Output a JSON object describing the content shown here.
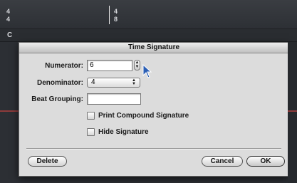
{
  "score": {
    "time_sig_left": [
      "4",
      "4"
    ],
    "time_sig_right": [
      "4",
      "8"
    ],
    "clef_letter": "C"
  },
  "dialog": {
    "title": "Time Signature",
    "numerator": {
      "label": "Numerator:",
      "value": "6"
    },
    "denominator": {
      "label": "Denominator:",
      "value": "4"
    },
    "beat_grouping": {
      "label": "Beat Grouping:",
      "value": ""
    },
    "print_compound": {
      "label": "Print Compound Signature",
      "checked": false
    },
    "hide_signature": {
      "label": "Hide Signature",
      "checked": false
    },
    "buttons": {
      "delete": "Delete",
      "cancel": "Cancel",
      "ok": "OK"
    }
  },
  "colors": {
    "background": "#2f3237",
    "dialog": "#dcdcdc",
    "accent_line": "#8e3b3b"
  },
  "icons": [
    "stepper-icon",
    "popup-arrows-icon",
    "mouse-pointer-icon"
  ]
}
